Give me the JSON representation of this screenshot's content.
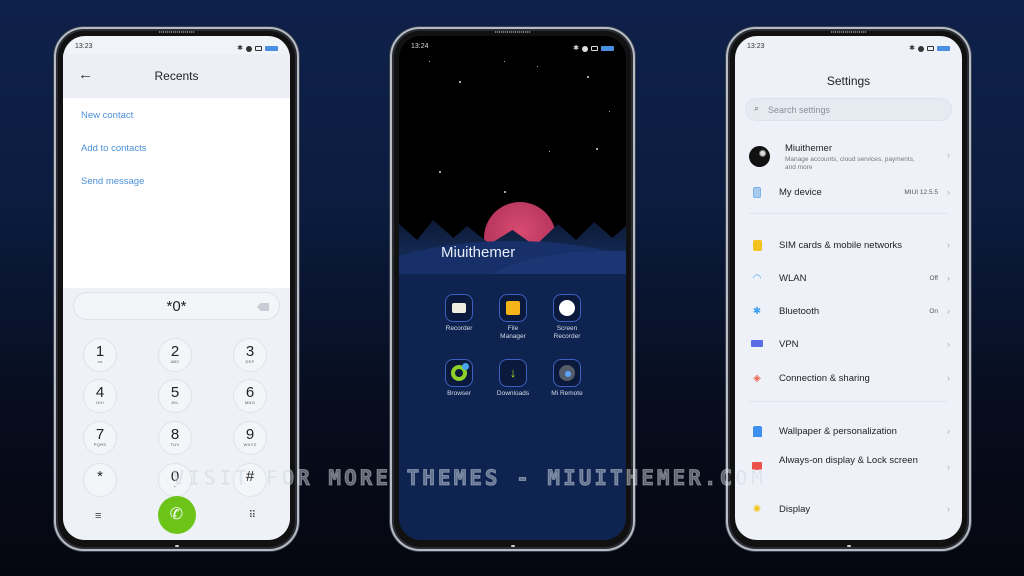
{
  "colors": {
    "background": "#0b1c3f",
    "link_blue": "#4a90d9",
    "call_green": "#6cc418",
    "sun_pink": "#c8385f"
  },
  "dialer": {
    "status_time": "13:23",
    "title": "Recents",
    "actions": [
      "New contact",
      "Add to contacts",
      "Send message"
    ],
    "number": "*0*",
    "keys": [
      {
        "digit": "1",
        "letters": "oo"
      },
      {
        "digit": "2",
        "letters": "ABC"
      },
      {
        "digit": "3",
        "letters": "DEF"
      },
      {
        "digit": "4",
        "letters": "GHI"
      },
      {
        "digit": "5",
        "letters": "JKL"
      },
      {
        "digit": "6",
        "letters": "MNO"
      },
      {
        "digit": "7",
        "letters": "PQRS"
      },
      {
        "digit": "8",
        "letters": "TUV"
      },
      {
        "digit": "9",
        "letters": "WXYZ"
      },
      {
        "digit": "*",
        "letters": ""
      },
      {
        "digit": "0",
        "letters": "+"
      },
      {
        "digit": "#",
        "letters": ""
      }
    ],
    "icons": {
      "back": "arrow-left-icon",
      "delete": "backspace-icon",
      "menu": "menu-icon",
      "call": "phone-icon",
      "dialpad": "dialpad-icon"
    }
  },
  "home": {
    "status_time": "13:24",
    "widget_title": "Miuithemer",
    "apps": [
      {
        "label": "Recorder",
        "icon": "recorder-icon"
      },
      {
        "label": "File Manager",
        "icon": "folder-icon"
      },
      {
        "label": "Screen Recorder",
        "icon": "screen-recorder-icon"
      },
      {
        "label": "Browser",
        "icon": "browser-icon"
      },
      {
        "label": "Downloads",
        "icon": "download-icon"
      },
      {
        "label": "Mi Remote",
        "icon": "remote-icon"
      }
    ]
  },
  "settings": {
    "status_time": "13:23",
    "title": "Settings",
    "search_placeholder": "Search settings",
    "account": {
      "name": "Miuithemer",
      "subtitle": "Manage accounts, cloud services, payments, and more"
    },
    "rows": [
      {
        "label": "My device",
        "value": "MIUI 12.5.5",
        "icon": "phone-device-icon"
      },
      {
        "label": "SIM cards & mobile networks",
        "value": "",
        "icon": "sim-card-icon"
      },
      {
        "label": "WLAN",
        "value": "Off",
        "icon": "wifi-icon"
      },
      {
        "label": "Bluetooth",
        "value": "On",
        "icon": "bluetooth-icon"
      },
      {
        "label": "VPN",
        "value": "",
        "icon": "vpn-icon"
      },
      {
        "label": "Connection & sharing",
        "value": "",
        "icon": "connection-sharing-icon"
      },
      {
        "label": "Wallpaper & personalization",
        "value": "",
        "icon": "wallpaper-icon"
      },
      {
        "label": "Always-on display & Lock screen",
        "value": "",
        "icon": "lock-icon"
      },
      {
        "label": "Display",
        "value": "",
        "icon": "sun-icon"
      }
    ]
  },
  "watermark": "VISIT FOR MORE THEMES - MIUITHEMER.COM"
}
